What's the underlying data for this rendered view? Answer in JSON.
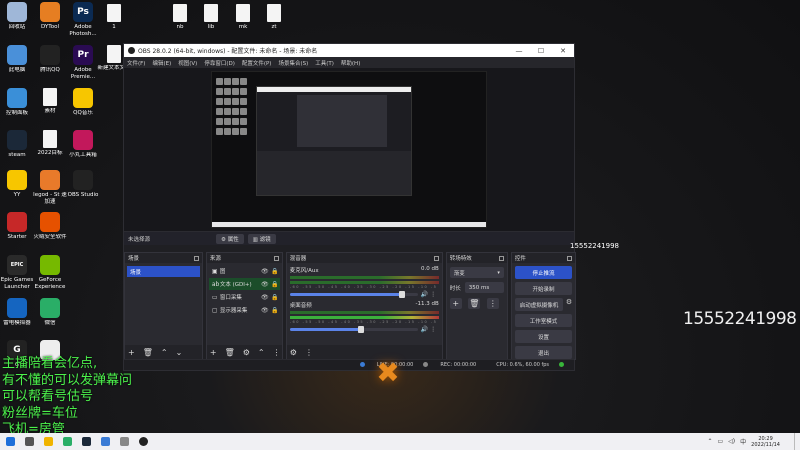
{
  "desktop": {
    "icons": [
      {
        "label": "回收站",
        "icon": "recycle-bin-icon",
        "color": "#9fb7d8"
      },
      {
        "label": "DYTool",
        "icon": "dytool-icon",
        "color": "#e67e22"
      },
      {
        "label": "Adobe Photosh...",
        "icon": "photoshop-icon",
        "color": "#0b2a52",
        "glyph": "Ps"
      },
      {
        "label": "1",
        "icon": "file-icon",
        "color": "#f4f4f4"
      },
      {
        "label": "nb",
        "icon": "file-icon",
        "color": "#f4f4f4"
      },
      {
        "label": "lib",
        "icon": "file-icon",
        "color": "#f4f4f4"
      },
      {
        "label": "mk",
        "icon": "file-icon",
        "color": "#f4f4f4"
      },
      {
        "label": "zt",
        "icon": "file-icon",
        "color": "#f4f4f4"
      },
      {
        "label": "此电脑",
        "icon": "computer-icon",
        "color": "#4a90d9"
      },
      {
        "label": "腾讯QQ",
        "icon": "qq-icon",
        "color": "#222"
      },
      {
        "label": "Adobe Premie...",
        "icon": "premiere-icon",
        "color": "#2a0b52",
        "glyph": "Pr"
      },
      {
        "label": "新建文本文档",
        "icon": "text-file-icon",
        "color": "#f4f4f4"
      },
      {
        "label": "控制面板",
        "icon": "control-panel-icon",
        "color": "#3a8fd8"
      },
      {
        "label": "素材",
        "icon": "file-icon",
        "color": "#f4f4f4"
      },
      {
        "label": "QQ音乐",
        "icon": "qq-music-icon",
        "color": "#f7c600"
      },
      {
        "label": "steam",
        "icon": "steam-icon",
        "color": "#1b2838"
      },
      {
        "label": "2022目标",
        "icon": "file-icon",
        "color": "#f4f4f4"
      },
      {
        "label": "小丸工具箱",
        "icon": "toolbox-icon",
        "color": "#c2185b"
      },
      {
        "label": "YY",
        "icon": "yy-icon",
        "color": "#f7c600"
      },
      {
        "label": "legod - St 速加速",
        "icon": "legod-icon",
        "color": "#e87a2a"
      },
      {
        "label": "OBS Studio",
        "icon": "obs-icon",
        "color": "#222"
      },
      {
        "label": "Starter",
        "icon": "starter-icon",
        "color": "#c62828"
      },
      {
        "label": "火绒安全软件",
        "icon": "huorong-icon",
        "color": "#e65100"
      },
      {
        "label": "Epic Games Launcher",
        "icon": "epic-icon",
        "color": "#2a2a2a",
        "glyph": "EPIC"
      },
      {
        "label": "GeForce Experience",
        "icon": "geforce-icon",
        "color": "#76b900"
      },
      {
        "label": "雷电模拟器",
        "icon": "emulator-icon",
        "color": "#1565c0"
      },
      {
        "label": "微信",
        "icon": "wechat-icon",
        "color": "#2aae67"
      },
      {
        "label": "G",
        "icon": "g-app-icon",
        "color": "#222",
        "glyph": "G"
      },
      {
        "label": "",
        "icon": "cat-icon",
        "color": "#eee"
      }
    ]
  },
  "obs": {
    "title": "OBS 28.0.2 (64-bit, windows) - 配置文件: 未命名 - 场景: 未命名",
    "menu": [
      "文件(F)",
      "编辑(E)",
      "视图(V)",
      "停靠窗口(D)",
      "配置文件(P)",
      "场景集合(S)",
      "工具(T)",
      "帮助(H)"
    ],
    "status_row": {
      "no_scene": "未选择源",
      "properties": "属性",
      "filters": "滤镜"
    },
    "docks": {
      "scenes": {
        "title": "场景",
        "items": [
          "场景"
        ]
      },
      "sources": {
        "title": "来源",
        "items": [
          {
            "name": "图",
            "icon": "image-icon",
            "selected": false
          },
          {
            "name": "文本 (GDI+)",
            "icon": "text-icon",
            "selected": true
          },
          {
            "name": "窗口采集",
            "icon": "window-icon",
            "selected": false
          },
          {
            "name": "显示器采集",
            "icon": "monitor-icon",
            "selected": false
          }
        ]
      },
      "mixer": {
        "title": "混音器",
        "channels": [
          {
            "name": "麦克风/Aux",
            "db": "0.0 dB",
            "volume": 0.88
          },
          {
            "name": "桌面音频",
            "db": "-11.3 dB",
            "volume": 0.56
          }
        ],
        "scale": "-60 -55 -50 -45 -40 -35 -30 -25 -20 -15 -10 -5 0"
      },
      "transitions": {
        "title": "转场特效",
        "selected": "渐变",
        "duration_label": "时长",
        "duration": "350 ms"
      },
      "controls": {
        "title": "控件",
        "buttons": [
          "停止推流",
          "开始录制",
          "启动虚拟摄像机",
          "工作室模式",
          "设置",
          "退出"
        ]
      }
    },
    "statusbar": {
      "live": "LIVE: 00:00:00",
      "rec": "REC: 00:00:00",
      "cpu": "CPU: 0.6%, 60.00 fps"
    }
  },
  "preview": {
    "phone": "15552241998"
  },
  "overlay": {
    "phone": "15552241998",
    "lines": [
      "主播陪看会亿点,",
      "有不懂的可以发弹幕问",
      "可以帮看号估号",
      "粉丝牌=车位",
      "飞机=房管"
    ]
  },
  "taskbar": {
    "time": "20:29",
    "date": "2022/11/14"
  },
  "colors": {
    "accent": "#2c52c8",
    "overlay_green": "#4cf24c",
    "selected_source": "#1b4d2a"
  }
}
